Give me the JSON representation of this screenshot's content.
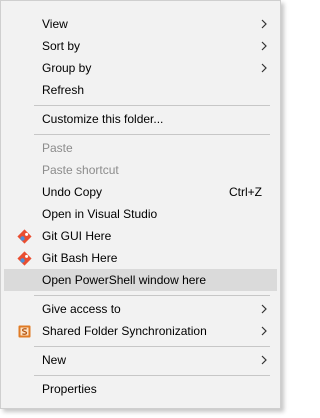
{
  "menu": {
    "items": [
      {
        "label": "View"
      },
      {
        "label": "Sort by"
      },
      {
        "label": "Group by"
      },
      {
        "label": "Refresh"
      },
      {
        "label": "Customize this folder..."
      },
      {
        "label": "Paste"
      },
      {
        "label": "Paste shortcut"
      },
      {
        "label": "Undo Copy",
        "shortcut": "Ctrl+Z"
      },
      {
        "label": "Open in Visual Studio"
      },
      {
        "label": "Git GUI Here",
        "icon": "git-diamond-icon"
      },
      {
        "label": "Git Bash Here",
        "icon": "git-diamond-icon"
      },
      {
        "label": "Open PowerShell window here"
      },
      {
        "label": "Give access to"
      },
      {
        "label": "Shared Folder Synchronization",
        "icon": "s-badge-icon"
      },
      {
        "label": "New"
      },
      {
        "label": "Properties"
      }
    ]
  },
  "colors": {
    "menu_background": "#f2f2f2",
    "highlight": "#dadada",
    "disabled_text": "#8c8c8c",
    "separator": "#c7c7c7",
    "git_red": "#e94e31",
    "git_blue": "#4a90d9",
    "sync_badge": "#e07b24"
  }
}
